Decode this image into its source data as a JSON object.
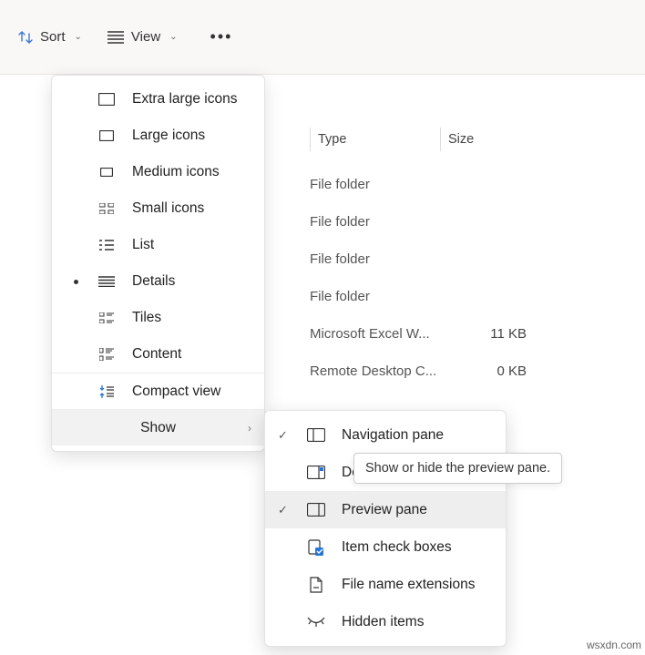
{
  "toolbar": {
    "sort": "Sort",
    "view": "View"
  },
  "headers": {
    "type": "Type",
    "size": "Size"
  },
  "rows": [
    {
      "type": "File folder",
      "size": ""
    },
    {
      "type": "File folder",
      "size": ""
    },
    {
      "type": "File folder",
      "size": ""
    },
    {
      "type": "File folder",
      "size": ""
    },
    {
      "type": "Microsoft Excel W...",
      "size": "11 KB"
    },
    {
      "type": "Remote Desktop C...",
      "size": "0 KB"
    }
  ],
  "viewMenu": {
    "extraLarge": "Extra large icons",
    "large": "Large icons",
    "medium": "Medium icons",
    "small": "Small icons",
    "list": "List",
    "details": "Details",
    "tiles": "Tiles",
    "content": "Content",
    "compact": "Compact view",
    "show": "Show"
  },
  "showMenu": {
    "nav": "Navigation pane",
    "details": "De",
    "preview": "Preview pane",
    "checks": "Item check boxes",
    "ext": "File name extensions",
    "hidden": "Hidden items"
  },
  "tooltip": "Show or hide the preview pane.",
  "watermark": "wsxdn.com"
}
